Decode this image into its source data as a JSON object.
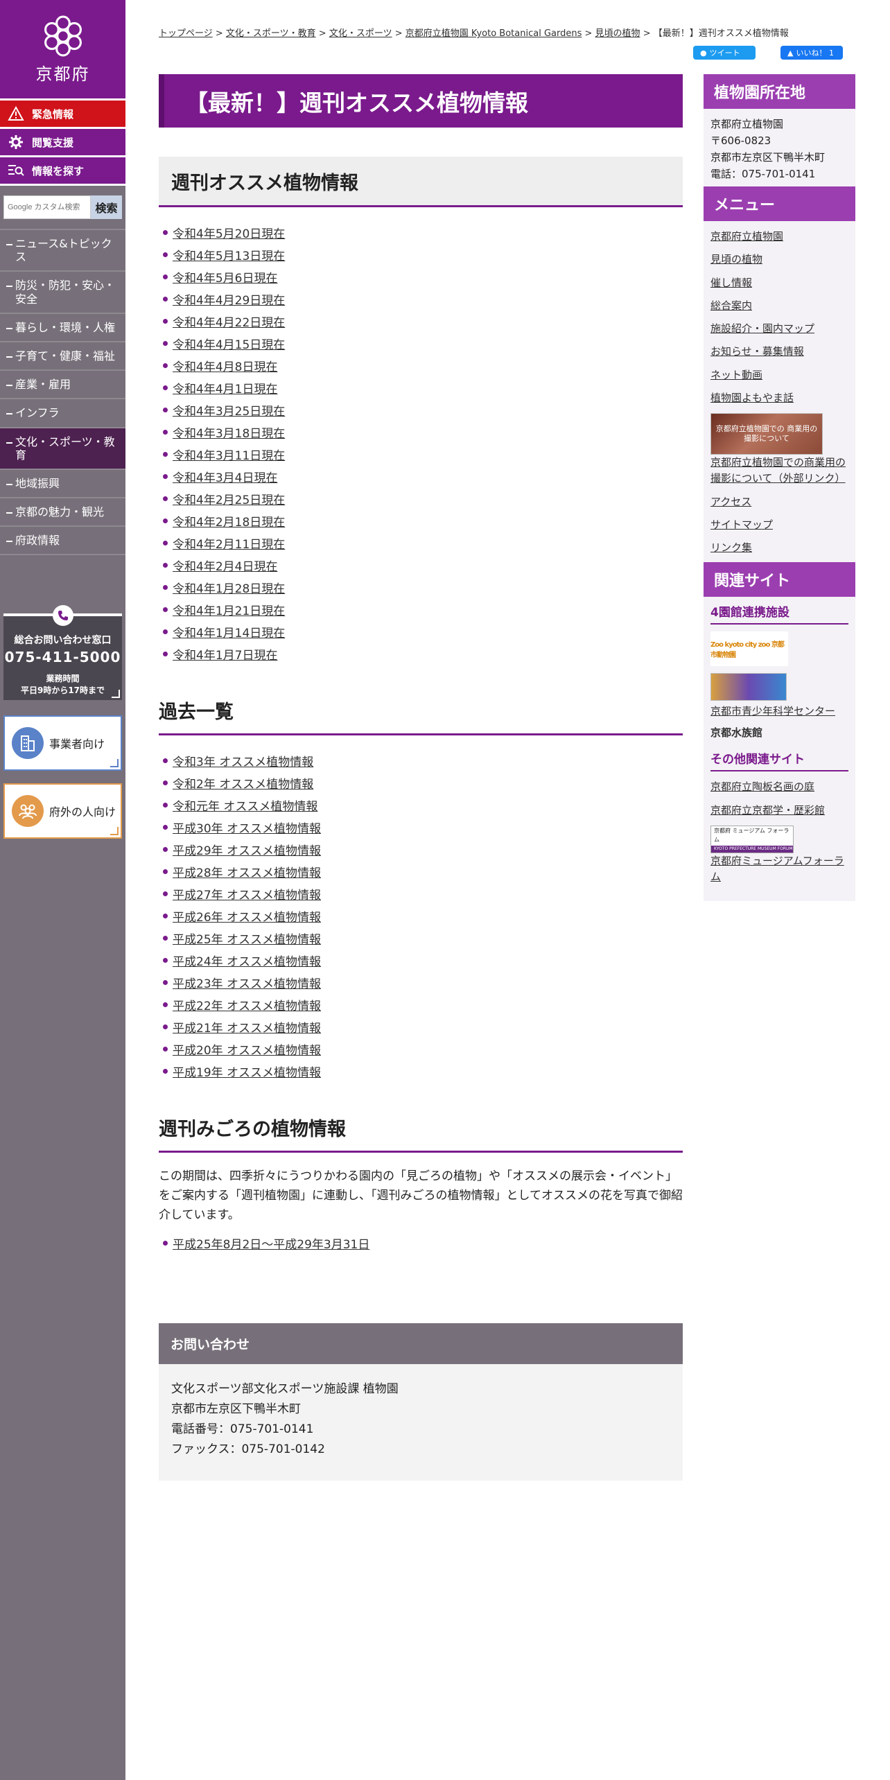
{
  "colors": {
    "brand_purple": "#7a1a8c",
    "emergency_red": "#d0121b",
    "sidebar_gray": "#77707a",
    "accent_purple": "#9b3fb0"
  },
  "logo": {
    "name": "京都府"
  },
  "sidebar": {
    "emergency": "緊急情報",
    "browse_support": "閲覧支援",
    "find_info": "情報を探す",
    "search_placeholder": "Google カスタム検索",
    "search_button": "検索",
    "nav": [
      {
        "label": "ニュース&トピックス"
      },
      {
        "label": "防災・防犯・安心・安全"
      },
      {
        "label": "暮らし・環境・人権"
      },
      {
        "label": "子育て・健康・福祉"
      },
      {
        "label": "産業・雇用"
      },
      {
        "label": "インフラ"
      },
      {
        "label": "文化・スポーツ・教育"
      },
      {
        "label": "地域振興"
      },
      {
        "label": "京都の魅力・観光"
      },
      {
        "label": "府政情報"
      }
    ],
    "contact": {
      "title": "総合お問い合わせ窓口",
      "phone": "075-411-5000",
      "hours_label": "業務時間",
      "hours": "平日9時から17時まで"
    },
    "business": "事業者向け",
    "outside": "府外の人向け"
  },
  "breadcrumb": {
    "items": [
      "トップページ",
      "文化・スポーツ・教育",
      "文化・スポーツ",
      "京都府立植物園 Kyoto Botanical Gardens",
      "見頃の植物"
    ],
    "sep": " > ",
    "current": "【最新！】週刊オススメ植物情報"
  },
  "social": {
    "tweet": "ツイート",
    "like": "いいね！ 1"
  },
  "main": {
    "title": "【最新！】週刊オススメ植物情報",
    "section1": {
      "heading": "週刊オススメ植物情報",
      "links": [
        "令和4年5月20日現在",
        "令和4年5月13日現在",
        "令和4年5月6日現在",
        "令和4年4月29日現在",
        "令和4年4月22日現在",
        "令和4年4月15日現在",
        "令和4年4月8日現在",
        "令和4年4月1日現在",
        "令和4年3月25日現在",
        "令和4年3月18日現在",
        "令和4年3月11日現在",
        "令和4年3月4日現在",
        "令和4年2月25日現在",
        "令和4年2月18日現在",
        "令和4年2月11日現在",
        "令和4年2月4日現在",
        "令和4年1月28日現在",
        "令和4年1月21日現在",
        "令和4年1月14日現在",
        "令和4年1月7日現在"
      ]
    },
    "section2": {
      "heading": "過去一覧",
      "links": [
        "令和3年 オススメ植物情報",
        "令和2年 オススメ植物情報",
        "令和元年 オススメ植物情報",
        "平成30年 オススメ植物情報",
        "平成29年 オススメ植物情報",
        "平成28年 オススメ植物情報",
        "平成27年 オススメ植物情報",
        "平成26年 オススメ植物情報",
        "平成25年 オススメ植物情報",
        "平成24年 オススメ植物情報",
        "平成23年 オススメ植物情報",
        "平成22年 オススメ植物情報",
        "平成21年 オススメ植物情報",
        "平成20年 オススメ植物情報",
        "平成19年 オススメ植物情報"
      ]
    },
    "section3": {
      "heading": "週刊みごろの植物情報",
      "text": "この期間は、四季折々にうつりかわる園内の「見ごろの植物」や「オススメの展示会・イベント」をご案内する「週刊植物園」に連動し、「週刊みごろの植物情報」としてオススメの花を写真で御紹介しています。",
      "links": [
        "平成25年8月2日～平成29年3月31日"
      ]
    }
  },
  "inquiry": {
    "heading": "お問い合わせ",
    "lines": [
      "文化スポーツ部文化スポーツ施設課 植物園",
      "京都市左京区下鴨半木町",
      "電話番号：075-701-0141",
      "ファックス：075-701-0142"
    ]
  },
  "right": {
    "location": {
      "heading": "植物園所在地",
      "lines": [
        "京都府立植物園",
        "〒606-0823",
        "京都市左京区下鴨半木町",
        "電話：075-701-0141"
      ]
    },
    "menu": {
      "heading": "メニュー",
      "links_a": [
        "京都府立植物園",
        "見頃の植物",
        "催し情報",
        "総合案内",
        "施設紹介・園内マップ",
        "お知らせ・募集情報",
        "ネット動画",
        "植物園よもやま話"
      ],
      "banner_text": "京都府立植物園での 商業用の撮影について",
      "banner_link": "京都府立植物園での商業用の撮影について（外部リンク）",
      "links_b": [
        "アクセス",
        "サイトマップ",
        "リンク集"
      ]
    },
    "related": {
      "heading": "関連サイト",
      "sub1": "4園館連携施設",
      "zoo_logo": "Zoo kyoto city zoo 京都市動物園",
      "science_center": "京都市青少年科学センター",
      "aquarium": "京都水族館",
      "sub2": "その他関連サイト",
      "other_links": [
        "京都府立陶板名画の庭",
        "京都府立京都学・歴彩館"
      ],
      "museum_logo_top": "京都府 ミュージアム フォーラム",
      "museum_logo_bar": "KYOTO PREFECTURE MUSEUM FORUM",
      "museum_link": "京都府ミュージアムフォーラム"
    }
  }
}
